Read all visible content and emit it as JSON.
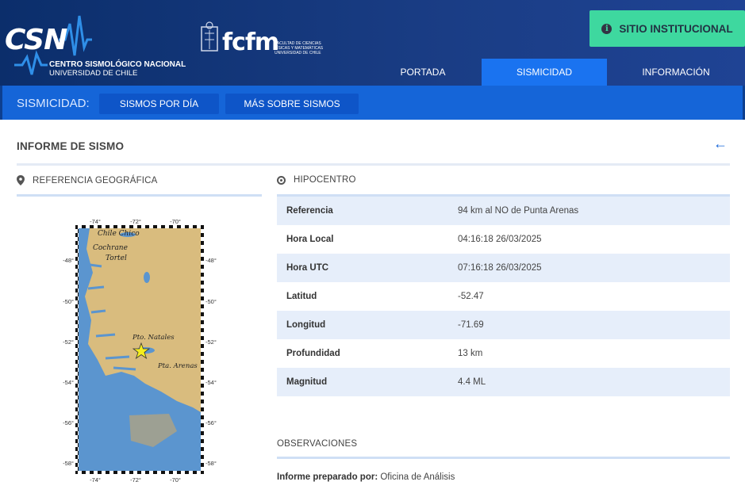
{
  "header": {
    "logo_text": "CSN",
    "logo_sub1": "CENTRO SISMOLÓGICO NACIONAL",
    "logo_sub2": "UNIVERSIDAD DE CHILE",
    "fcfm_text": "fcfm",
    "fcfm_small": "FACULTAD DE CIENCIAS FÍSICAS Y MATEMÁTICAS UNIVERSIDAD DE CHILE",
    "sitio_label": "SITIO INSTITUCIONAL",
    "nav": [
      "PORTADA",
      "SISMICIDAD",
      "INFORMACIÓN"
    ],
    "active_tab": "SISMICIDAD"
  },
  "subbar": {
    "label": "SISMICIDAD:",
    "buttons": [
      "SISMOS POR DÍA",
      "MÁS SOBRE SISMOS"
    ]
  },
  "page": {
    "title": "INFORME DE SISMO",
    "geo_heading": "REFERENCIA GEOGRÁFICA",
    "hipo_heading": "HIPOCENTRO",
    "obs_heading": "OBSERVACIONES",
    "obs_label": "Informe preparado por:",
    "obs_value": "Oficina de Análisis"
  },
  "map": {
    "top_ticks": [
      "-74°",
      "-72°",
      "-70°"
    ],
    "bottom_ticks": [
      "-74°",
      "-72°",
      "-70°"
    ],
    "left_ticks": [
      "-48°",
      "-50°",
      "-52°",
      "-54°",
      "-56°",
      "-58°"
    ],
    "right_ticks": [
      "-48°",
      "-50°",
      "-52°",
      "-54°",
      "-56°",
      "-58°"
    ],
    "places": [
      "Chile Chico",
      "Cochrane",
      "Tortel",
      "Pto. Natales",
      "Pta. Arenas"
    ],
    "land_color": "#d9bc7e",
    "sea_color": "#5b95cf",
    "epicenter_color": "#f5ee1e"
  },
  "hipocentro": [
    {
      "key": "Referencia",
      "value": "94 km al NO de Punta Arenas"
    },
    {
      "key": "Hora Local",
      "value": "04:16:18 26/03/2025"
    },
    {
      "key": "Hora UTC",
      "value": "07:16:18 26/03/2025"
    },
    {
      "key": "Latitud",
      "value": "-52.47"
    },
    {
      "key": "Longitud",
      "value": "-71.69"
    },
    {
      "key": "Profundidad",
      "value": "13 km"
    },
    {
      "key": "Magnitud",
      "value": "4.4 ML"
    }
  ],
  "colors": {
    "header_bg": "#0b2e6b",
    "accent_green": "#3ed89f",
    "active_blue": "#1a73f0",
    "subbar_blue": "#1565d8",
    "row_stripe": "#e6eefa"
  }
}
